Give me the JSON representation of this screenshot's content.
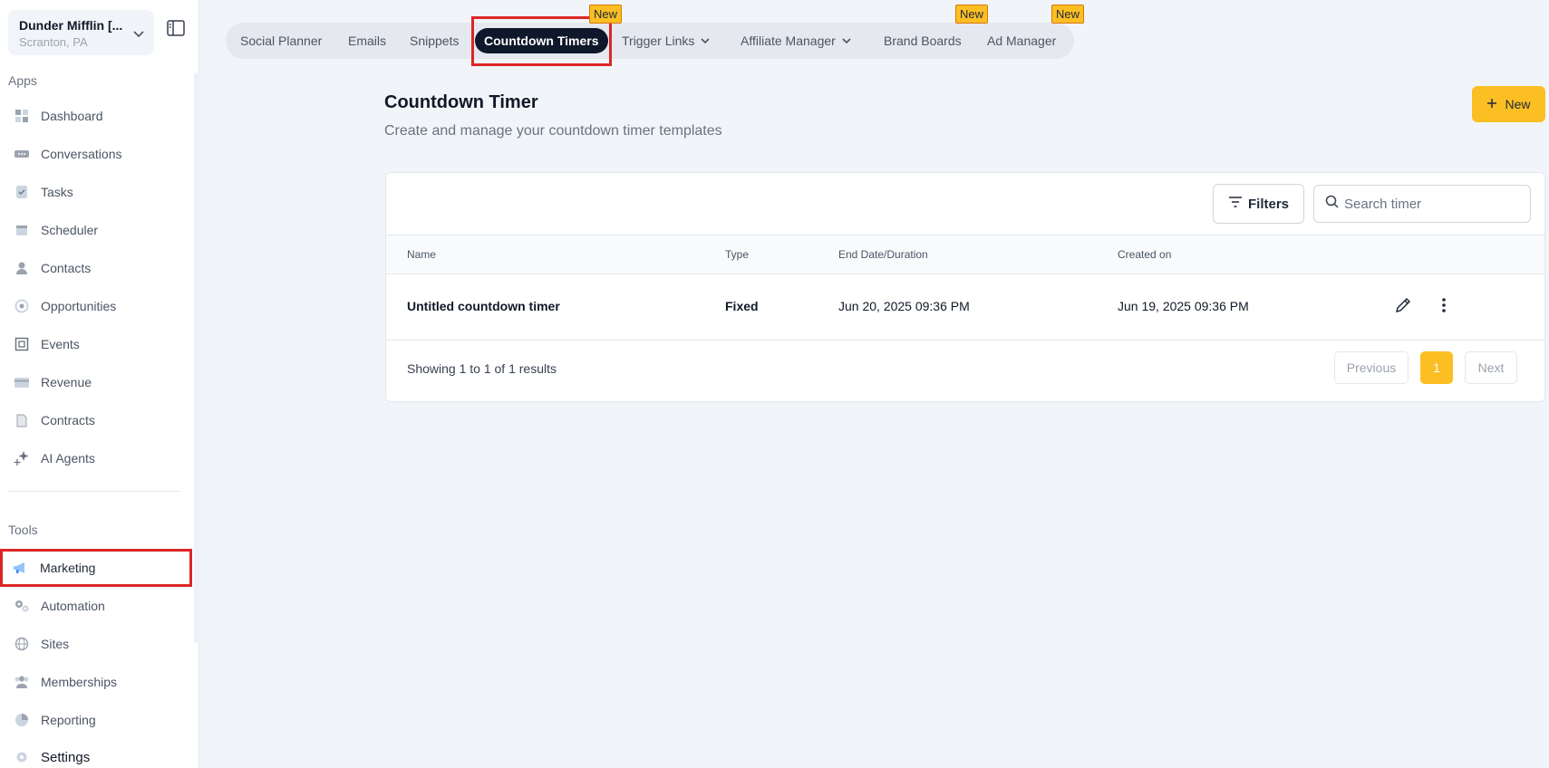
{
  "account": {
    "name": "Dunder Mifflin [...",
    "location": "Scranton, PA"
  },
  "sidebar": {
    "apps_label": "Apps",
    "apps": [
      {
        "label": "Dashboard",
        "icon": "dashboard-icon"
      },
      {
        "label": "Conversations",
        "icon": "chat-icon"
      },
      {
        "label": "Tasks",
        "icon": "task-icon"
      },
      {
        "label": "Scheduler",
        "icon": "calendar-icon"
      },
      {
        "label": "Contacts",
        "icon": "person-icon"
      },
      {
        "label": "Opportunities",
        "icon": "target-icon"
      },
      {
        "label": "Events",
        "icon": "events-icon"
      },
      {
        "label": "Revenue",
        "icon": "card-icon"
      },
      {
        "label": "Contracts",
        "icon": "document-icon"
      },
      {
        "label": "AI Agents",
        "icon": "sparkle-icon"
      }
    ],
    "tools_label": "Tools",
    "tools": [
      {
        "label": "Marketing",
        "icon": "megaphone-icon",
        "active": true
      },
      {
        "label": "Automation",
        "icon": "gears-icon"
      },
      {
        "label": "Sites",
        "icon": "globe-icon"
      },
      {
        "label": "Memberships",
        "icon": "people-icon"
      },
      {
        "label": "Reporting",
        "icon": "pie-icon"
      },
      {
        "label": "Settings",
        "icon": "gear-icon"
      }
    ]
  },
  "tabs": [
    {
      "label": "Social Planner"
    },
    {
      "label": "Emails"
    },
    {
      "label": "Snippets"
    },
    {
      "label": "Countdown Timers",
      "active": true,
      "badge": "New"
    },
    {
      "label": "Trigger Links",
      "dropdown": true
    },
    {
      "label": "Affiliate Manager",
      "dropdown": true
    },
    {
      "label": "Brand Boards",
      "badge": "New"
    },
    {
      "label": "Ad Manager",
      "badge": "New"
    }
  ],
  "header": {
    "title": "Countdown Timer",
    "subtitle": "Create and manage your countdown timer templates",
    "new_button": "New"
  },
  "toolbar": {
    "filters_label": "Filters",
    "search_placeholder": "Search timer"
  },
  "table": {
    "columns": [
      "Name",
      "Type",
      "End Date/Duration",
      "Created on"
    ],
    "rows": [
      {
        "name": "Untitled countdown timer",
        "type": "Fixed",
        "end": "Jun 20, 2025 09:36 PM",
        "created": "Jun 19, 2025 09:36 PM"
      }
    ]
  },
  "pagination": {
    "summary": "Showing 1 to 1 of 1 results",
    "previous": "Previous",
    "page": "1",
    "next": "Next"
  },
  "colors": {
    "accent": "#fbbf24",
    "active_tab": "#0f172a",
    "highlight": "#dc2626"
  }
}
